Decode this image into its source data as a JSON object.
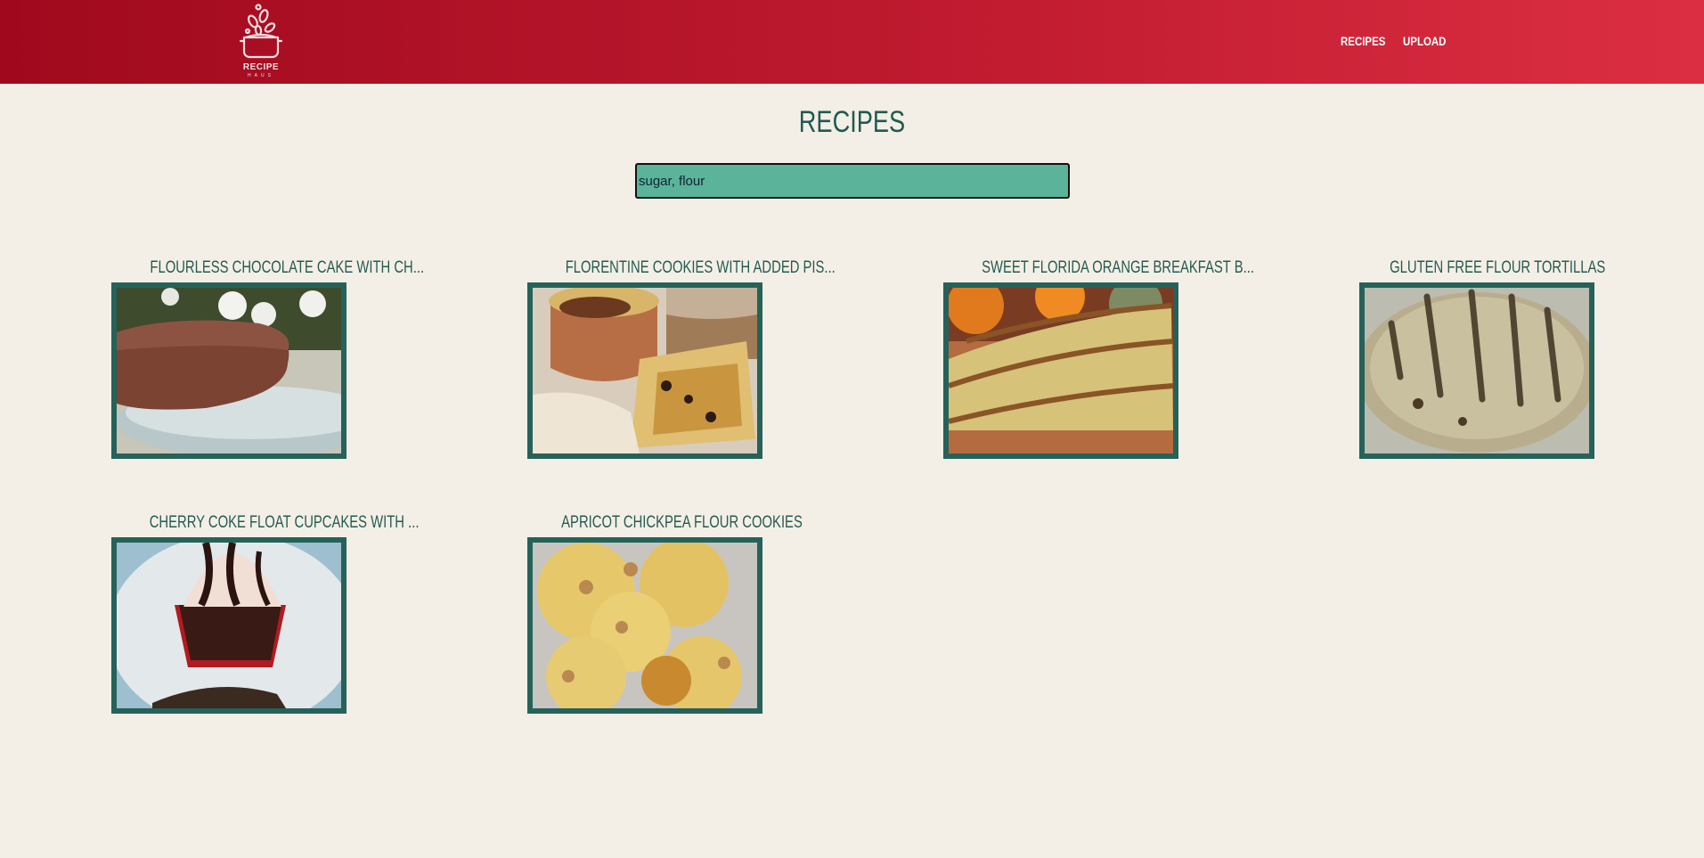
{
  "header": {
    "logo_text": "RECIPE",
    "logo_subtext": "HAUS",
    "nav": [
      {
        "label": "RECIPES"
      },
      {
        "label": "UPLOAD"
      }
    ]
  },
  "main": {
    "title": "RECIPES",
    "search": {
      "value": "sugar, flour"
    },
    "recipes": [
      {
        "title": "FLOURLESS CHOCOLATE CAKE WITH CH..."
      },
      {
        "title": "FLORENTINE COOKIES WITH ADDED PIS..."
      },
      {
        "title": "SWEET FLORIDA ORANGE BREAKFAST B..."
      },
      {
        "title": "GLUTEN FREE FLOUR TORTILLAS"
      },
      {
        "title": "CHERRY COKE FLOAT CUPCAKES WITH ..."
      },
      {
        "title": "APRICOT CHICKPEA FLOUR COOKIES"
      }
    ]
  },
  "colors": {
    "header_start": "#a0091d",
    "header_end": "#dc2e42",
    "background": "#f4efe6",
    "accent_green": "#25625a",
    "search_bg": "#5bb39a"
  }
}
